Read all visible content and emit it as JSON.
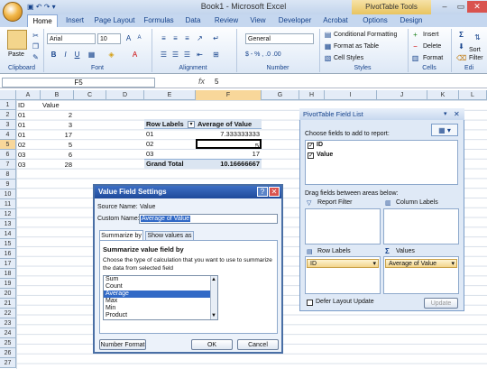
{
  "window": {
    "title": "Book1 - Microsoft Excel",
    "context_tab": "PivotTable Tools"
  },
  "tabs": [
    "Home",
    "Insert",
    "Page Layout",
    "Formulas",
    "Data",
    "Review",
    "View",
    "Developer",
    "Acrobat",
    "Options",
    "Design"
  ],
  "ribbon": {
    "clipboard": {
      "paste": "Paste",
      "label": "Clipboard"
    },
    "font": {
      "name": "Arial",
      "size": "10",
      "label": "Font"
    },
    "alignment": {
      "label": "Alignment"
    },
    "number": {
      "format": "General",
      "symbols": "$ - % , .0 .00",
      "label": "Number"
    },
    "styles": {
      "conditional": "Conditional Formatting",
      "table": "Format as Table",
      "cell": "Cell Styles",
      "label": "Styles"
    },
    "cells": {
      "insert": "Insert",
      "delete": "Delete",
      "format": "Format",
      "label": "Cells"
    },
    "editing": {
      "sort": "Sort",
      "filter": "Filter",
      "label": "Edi"
    }
  },
  "formula_bar": {
    "name_box": "F5",
    "fx": "fx",
    "value": "5"
  },
  "columns": [
    "A",
    "B",
    "C",
    "D",
    "E",
    "F",
    "G",
    "H",
    "I",
    "J",
    "K",
    "L"
  ],
  "rows": [
    "1",
    "2",
    "3",
    "4",
    "5",
    "6",
    "7",
    "8",
    "9",
    "10",
    "11",
    "12",
    "13",
    "14",
    "15",
    "16",
    "17",
    "18",
    "19",
    "20",
    "21",
    "22",
    "23",
    "24",
    "25",
    "26",
    "27"
  ],
  "cells": {
    "A1": "ID",
    "B1": "Value",
    "A2": "01",
    "B2": "2",
    "A3": "01",
    "B3": "3",
    "A4": "01",
    "B4": "17",
    "A5": "02",
    "B5": "5",
    "A6": "03",
    "B6": "6",
    "A7": "03",
    "B7": "28"
  },
  "pivot": {
    "header_labels": "Row Labels",
    "header_values": "Average of Value",
    "rows": [
      {
        "label": "01",
        "value": "7.333333333"
      },
      {
        "label": "02",
        "value": "5"
      },
      {
        "label": "03",
        "value": "17"
      }
    ],
    "total_label": "Grand Total",
    "total_value": "10.16666667"
  },
  "field_list": {
    "title": "PivotTable Field List",
    "choose": "Choose fields to add to report:",
    "fields": [
      "ID",
      "Value"
    ],
    "drag_label": "Drag fields between areas below:",
    "report_filter": "Report Filter",
    "column_labels": "Column Labels",
    "row_labels": "Row Labels",
    "values": "Values",
    "row_item": "ID",
    "value_item": "Average of Value",
    "defer": "Defer Layout Update",
    "update": "Update"
  },
  "dialog": {
    "title": "Value Field Settings",
    "source_label": "Source Name:",
    "source_value": "Value",
    "custom_label": "Custom Name:",
    "custom_value": "Average of Value",
    "tab1": "Summarize by",
    "tab2": "Show values as",
    "section": "Summarize value field by",
    "desc1": "Choose the type of calculation that you want to use to summarize",
    "desc2": "the data from selected field",
    "options": [
      "Sum",
      "Count",
      "Average",
      "Max",
      "Min",
      "Product"
    ],
    "selected": "Average",
    "number_format": "Number Format",
    "ok": "OK",
    "cancel": "Cancel"
  }
}
